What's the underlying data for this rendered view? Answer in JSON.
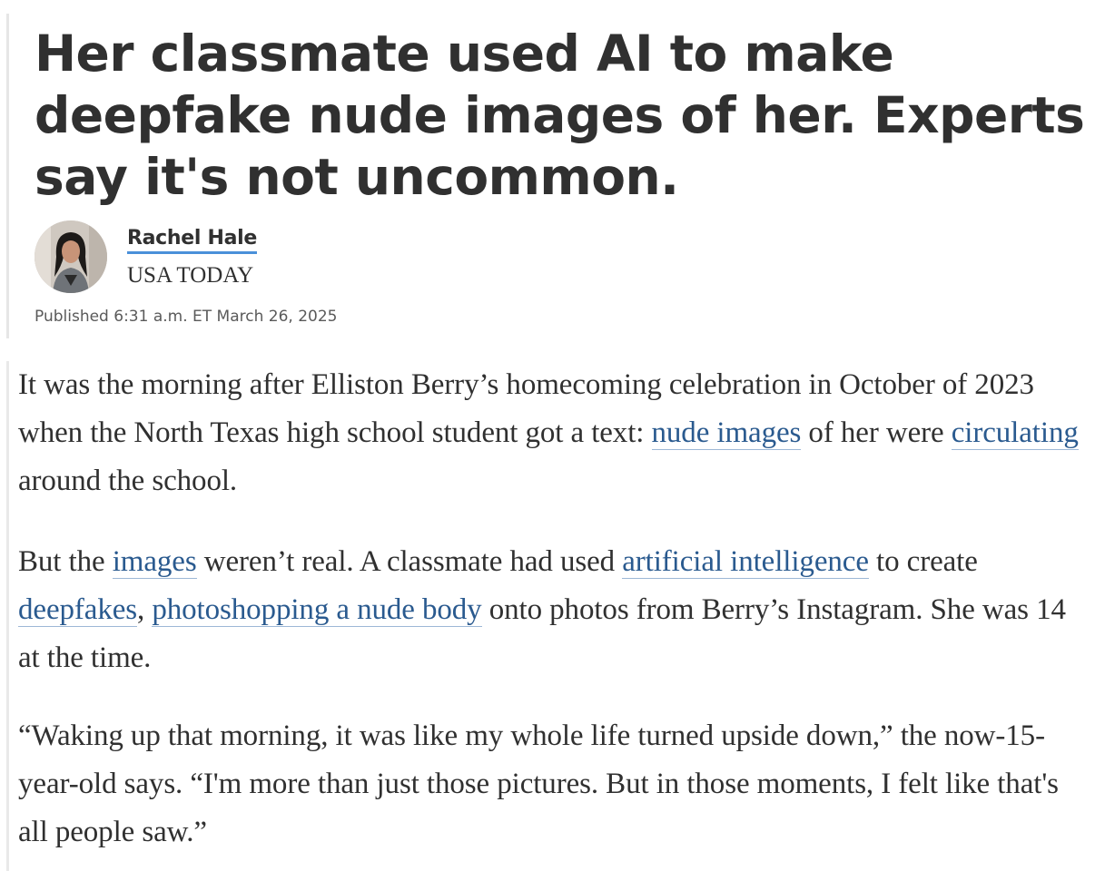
{
  "article": {
    "headline": "Her classmate used AI to make deepfake nude images of her. Experts say it's not uncommon.",
    "author": {
      "name": "Rachel Hale",
      "publication": "USA TODAY"
    },
    "published": "Published 6:31 a.m. ET March 26, 2025"
  },
  "body": {
    "p1": {
      "t1": "It was the morning after Elliston Berry’s homecoming celebration in October of 2023 when the North Texas high school student got a text: ",
      "link1": "nude images",
      "t2": " of her were ",
      "link2": "circulating",
      "t3": " around the school."
    },
    "p2": {
      "t1": "But the ",
      "link1": "images",
      "t2": " weren’t real. A classmate had used ",
      "link2": "artificial intelligence",
      "t3": " to create ",
      "link3": "deepfakes",
      "t4": ", ",
      "link4": "photoshopping a nude body",
      "t5": " onto photos from Berry’s Instagram. She was 14 at the time."
    },
    "p3": {
      "text": "“Waking up that morning, it was like my whole life turned upside down,” the now-15-year-old says. “I'm more than just those pictures. But in those moments, I felt like that's all people saw.”"
    }
  },
  "colors": {
    "link": "#2a5a8f",
    "author_underline": "#4a90d9",
    "text": "#303030"
  },
  "icons": {
    "author_photo": "author-avatar-photo"
  }
}
